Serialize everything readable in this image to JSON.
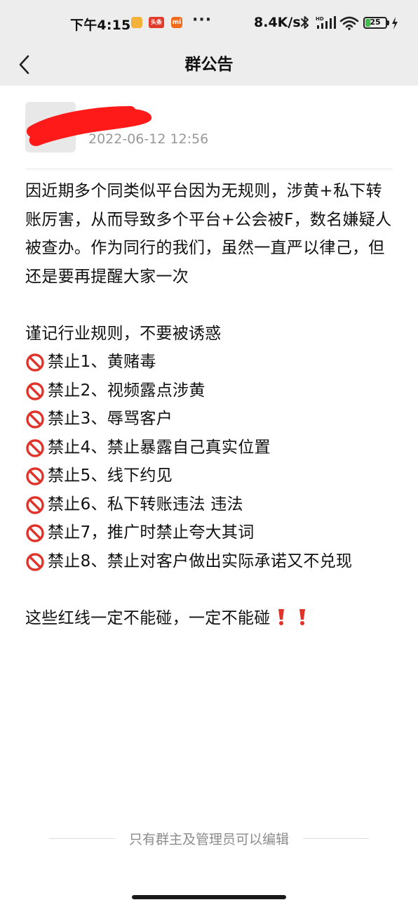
{
  "status_bar": {
    "time": "下午4:15",
    "app_icons": [
      "notes-app-icon",
      "toutiao-app-icon",
      "mi-app-icon"
    ],
    "toutiao_label": "头条",
    "mi_label": "mi",
    "more_dots": "···",
    "net_speed": "8.4K/s",
    "battery_level": "25",
    "icons": [
      "bluetooth-icon",
      "signal-hd-icon",
      "wifi-icon",
      "battery-icon",
      "charging-bolt-icon"
    ]
  },
  "nav": {
    "back_icon": "chevron-left-icon",
    "title": "群公告"
  },
  "announcement": {
    "author_avatar": "redacted-avatar",
    "timestamp": "2022-06-12 12:56",
    "intro": "因近期多个同类似平台因为无规则，涉黄+私下转账厉害，从而导致多个平台+公会被F，数名嫌疑人被查办。作为同行的我们，虽然一直严以律己，但还是要再提醒大家一次",
    "rules_heading": "谨记行业规则，不要被诱惑",
    "rules": [
      "禁止1、黄赌毒",
      "禁止2、视频露点涉黄",
      "禁止3、辱骂客户",
      "禁止4、禁止暴露自己真实位置",
      "禁止5、线下约见",
      "禁止6、私下转账违法 违法",
      "禁止7，推广时禁止夸大其词",
      "禁止8、禁止对客户做出实际承诺又不兑现"
    ],
    "rule_icon": "prohibited-icon",
    "closing": "这些红线一定不能碰，一定不能碰",
    "closing_icons": [
      "exclamation-icon",
      "exclamation-icon"
    ]
  },
  "footer": {
    "note": "只有群主及管理员可以编辑"
  },
  "colors": {
    "bar_bg": "#ededed",
    "prohibit_red": "#e0342b",
    "timestamp_gray": "#999999"
  }
}
